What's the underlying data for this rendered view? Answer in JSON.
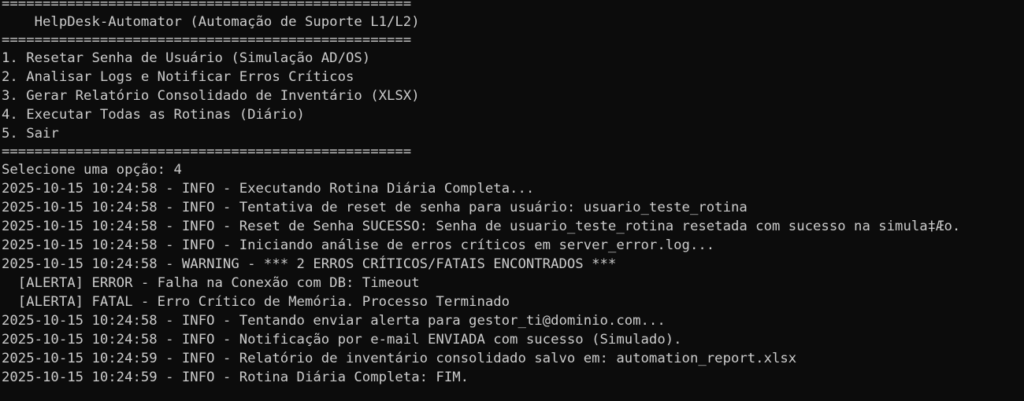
{
  "terminal": {
    "separator": "==================================================",
    "title": "    HelpDesk-Automator (Automação de Suporte L1/L2)",
    "menu": [
      "1. Resetar Senha de Usuário (Simulação AD/OS)",
      "2. Analisar Logs e Notificar Erros Críticos",
      "3. Gerar Relatório Consolidado de Inventário (XLSX)",
      "4. Executar Todas as Rotinas (Diário)",
      "5. Sair"
    ],
    "prompt": "Selecione uma opção: ",
    "input": "4",
    "log": [
      "2025-10-15 10:24:58 - INFO - Executando Rotina Diária Completa...",
      "2025-10-15 10:24:58 - INFO - Tentativa de reset de senha para usuário: usuario_teste_rotina",
      "2025-10-15 10:24:58 - INFO - Reset de Senha SUCESSO: Senha de usuario_teste_rotina resetada com sucesso na simula‡Æo.",
      "2025-10-15 10:24:58 - INFO - Iniciando análise de erros críticos em server_error.log...",
      "2025-10-15 10:24:58 - WARNING - *** 2 ERROS CRÍTICOS/FATAIS ENCONTRADOS ***",
      "  [ALERTA] ERROR - Falha na Conexão com DB: Timeout",
      "  [ALERTA] FATAL - Erro Crítico de Memória. Processo Terminado",
      "2025-10-15 10:24:58 - INFO - Tentando enviar alerta para gestor_ti@dominio.com...",
      "2025-10-15 10:24:58 - INFO - Notificação por e-mail ENVIADA com sucesso (Simulado).",
      "2025-10-15 10:24:59 - INFO - Relatório de inventário consolidado salvo em: automation_report.xlsx",
      "2025-10-15 10:24:59 - INFO - Rotina Diária Completa: FIM."
    ],
    "colors": {
      "background": "#0c0c0c",
      "text": "#cccccc"
    }
  }
}
